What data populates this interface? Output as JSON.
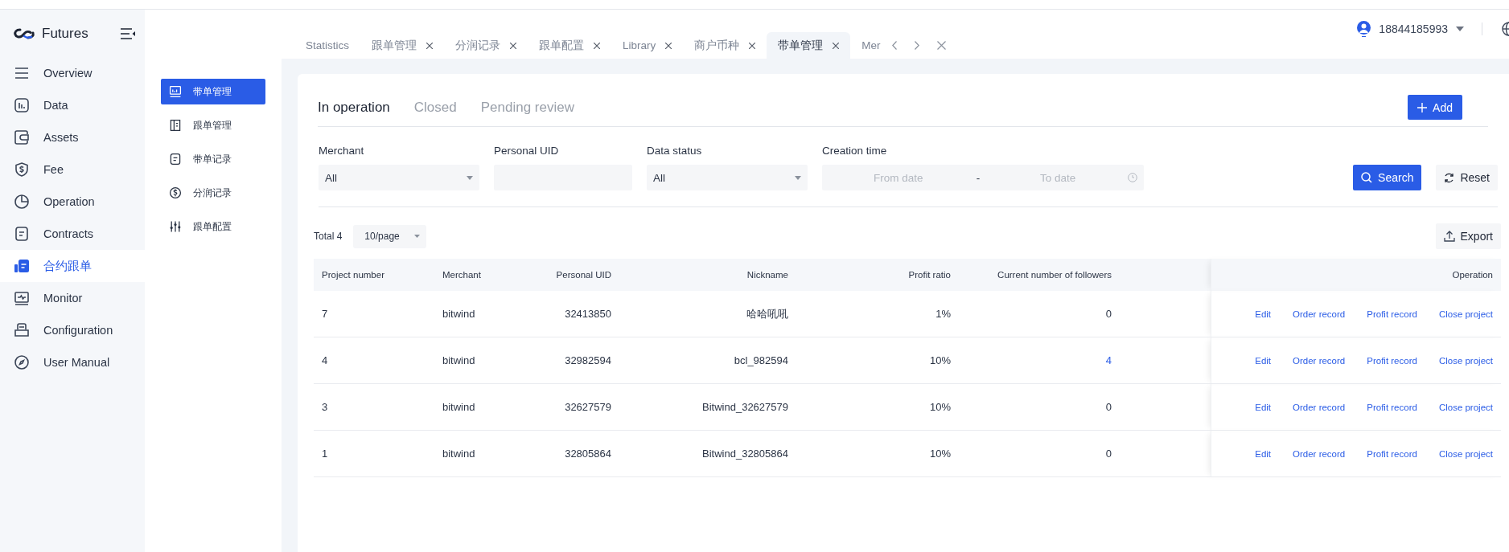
{
  "sidebar": {
    "logo": "Futures",
    "items": [
      {
        "label": "Overview",
        "selected": false
      },
      {
        "label": "Data",
        "selected": false
      },
      {
        "label": "Assets",
        "selected": false
      },
      {
        "label": "Fee",
        "selected": false
      },
      {
        "label": "Operation",
        "selected": false
      },
      {
        "label": "Contracts",
        "selected": false
      },
      {
        "label": "合约跟单",
        "selected": true
      },
      {
        "label": "Monitor",
        "selected": false
      },
      {
        "label": "Configuration",
        "selected": false
      },
      {
        "label": "User Manual",
        "selected": false
      }
    ]
  },
  "submenu": [
    {
      "label": "带单管理",
      "selected": true
    },
    {
      "label": "跟单管理",
      "selected": false
    },
    {
      "label": "带单记录",
      "selected": false
    },
    {
      "label": "分润记录",
      "selected": false
    },
    {
      "label": "跟单配置",
      "selected": false
    }
  ],
  "page_tabs": [
    {
      "label": "Statistics",
      "closable": false,
      "selected": false
    },
    {
      "label": "跟单管理",
      "closable": true,
      "selected": false
    },
    {
      "label": "分润记录",
      "closable": true,
      "selected": false
    },
    {
      "label": "跟单配置",
      "closable": true,
      "selected": false
    },
    {
      "label": "Library",
      "closable": true,
      "selected": false
    },
    {
      "label": "商户币种",
      "closable": true,
      "selected": false
    },
    {
      "label": "带单管理",
      "closable": true,
      "selected": true
    },
    {
      "label": "Mer",
      "closable": false,
      "selected": false
    }
  ],
  "user": {
    "phone": "18844185993"
  },
  "status_tabs": [
    {
      "label": "In operation",
      "selected": true
    },
    {
      "label": "Closed",
      "selected": false
    },
    {
      "label": "Pending review",
      "selected": false
    }
  ],
  "add_button": "Add",
  "filters": [
    {
      "kind": "select",
      "label": "Merchant",
      "value": "All"
    },
    {
      "kind": "input",
      "label": "Personal UID"
    },
    {
      "kind": "select",
      "label": "Data status",
      "value": "All"
    },
    {
      "kind": "daterange",
      "label": "Creation time",
      "start_placeholder": "From date",
      "separator": "-",
      "end_placeholder": "To date"
    }
  ],
  "search_button": "Search",
  "reset_button": "Reset",
  "pagination": {
    "total": "Total 4",
    "page_size": "10/page"
  },
  "export_button": "Export",
  "table": {
    "columns": [
      "Project number",
      "Merchant",
      "Personal UID",
      "Nickname",
      "Profit ratio",
      "Current number of followers",
      "Operation"
    ],
    "rows": [
      {
        "project_number": "7",
        "merchant": "bitwind",
        "personal_uid": "32413850",
        "nickname": "哈哈吼吼",
        "profit_ratio": "1%",
        "followers": "0",
        "followers_link": false,
        "operations": [
          "Edit",
          "Order record",
          "Profit record",
          "Close project"
        ]
      },
      {
        "project_number": "4",
        "merchant": "bitwind",
        "personal_uid": "32982594",
        "nickname": "bcl_982594",
        "profit_ratio": "10%",
        "followers": "4",
        "followers_link": true,
        "operations": [
          "Edit",
          "Order record",
          "Profit record",
          "Close project"
        ]
      },
      {
        "project_number": "3",
        "merchant": "bitwind",
        "personal_uid": "32627579",
        "nickname": "Bitwind_32627579",
        "profit_ratio": "10%",
        "followers": "0",
        "followers_link": false,
        "operations": [
          "Edit",
          "Order record",
          "Profit record",
          "Close project"
        ]
      },
      {
        "project_number": "1",
        "merchant": "bitwind",
        "personal_uid": "32805864",
        "nickname": "Bitwind_32805864",
        "profit_ratio": "10%",
        "followers": "0",
        "followers_link": false,
        "operations": [
          "Edit",
          "Order record",
          "Profit record",
          "Close project"
        ]
      }
    ]
  }
}
